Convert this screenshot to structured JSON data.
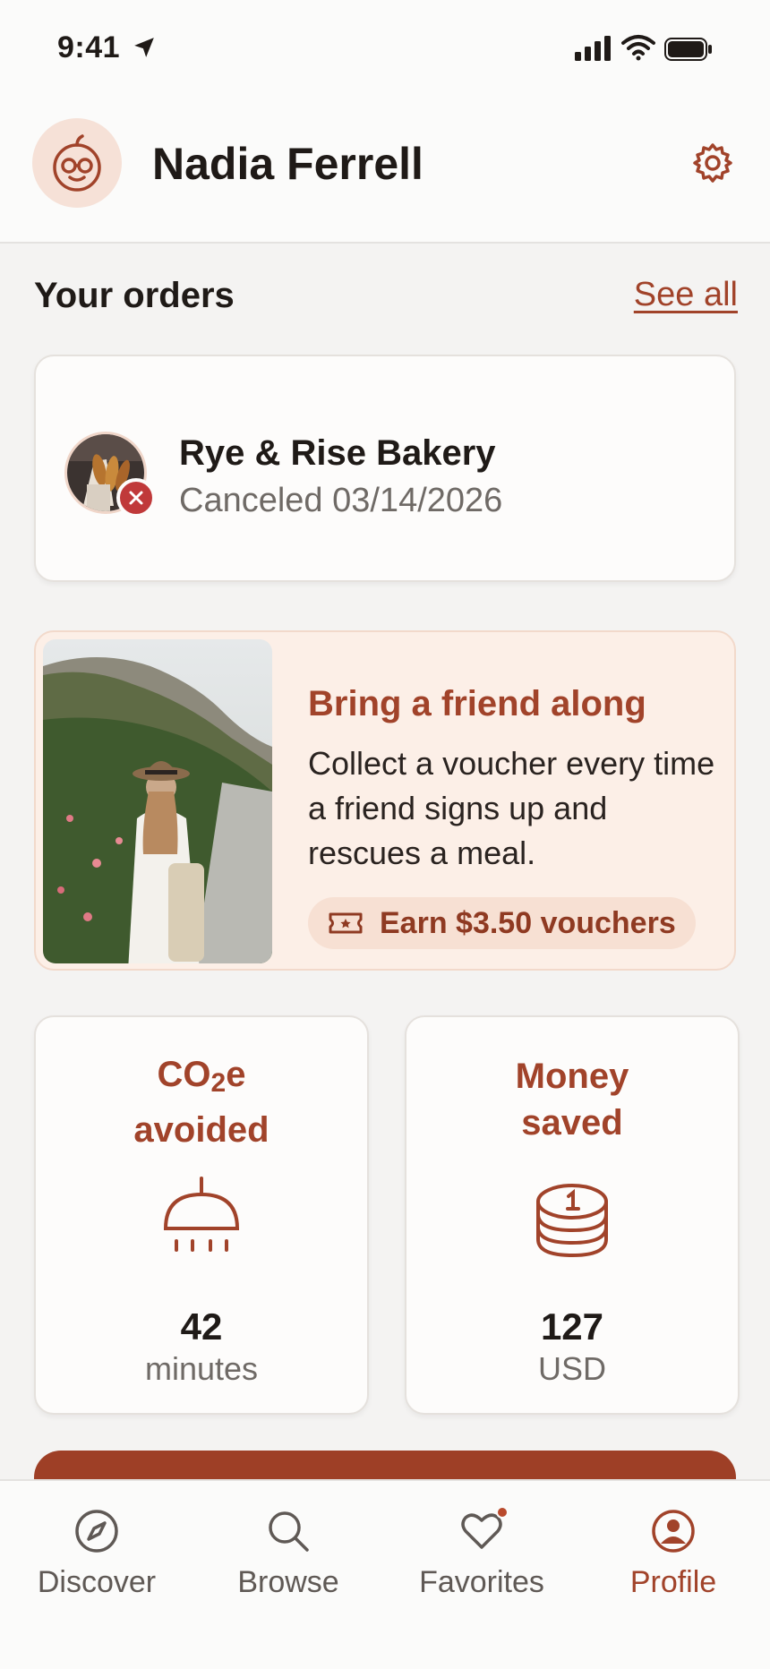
{
  "status_bar": {
    "time": "9:41"
  },
  "header": {
    "user_name": "Nadia Ferrell"
  },
  "orders": {
    "title": "Your orders",
    "see_all": "See all",
    "items": [
      {
        "store": "Rye & Rise Bakery",
        "status": "Canceled 03/14/2026"
      }
    ]
  },
  "promo": {
    "title": "Bring a friend along",
    "text": "Collect a voucher every time a friend signs up and rescues a meal.",
    "chip": "Earn $3.50 vouchers"
  },
  "stats": {
    "co2": {
      "title_main": "CO",
      "title_sub": "2",
      "title_rest": "e",
      "title_line2": "avoided",
      "value": "42",
      "unit": "minutes",
      "icon": "shower-icon"
    },
    "money": {
      "title_line1": "Money",
      "title_line2": "saved",
      "value": "127",
      "unit": "USD",
      "icon": "coin-stack-icon"
    }
  },
  "nav": {
    "items": [
      {
        "label": "Discover",
        "icon": "compass-icon"
      },
      {
        "label": "Browse",
        "icon": "search-icon"
      },
      {
        "label": "Favorites",
        "icon": "heart-icon"
      },
      {
        "label": "Profile",
        "icon": "profile-icon"
      }
    ],
    "active": "Profile"
  },
  "colors": {
    "accent": "#a1432a",
    "cta": "#9e3f26",
    "promo_bg": "#fcefe7",
    "cancel_badge": "#c0393a"
  }
}
